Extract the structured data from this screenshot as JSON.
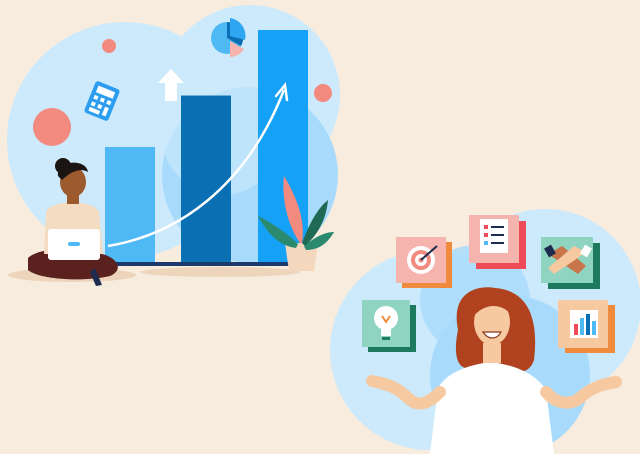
{
  "illustration": {
    "colors": {
      "background": "#f8ecde",
      "circle_light": "#cdeafc",
      "circle_mid": "#a8dbfb",
      "bar_light": "#4fb9f5",
      "bar_dark": "#0b6fb3",
      "bar_bright": "#15a1f6",
      "accent_coral": "#f28a80",
      "skin_dark": "#9c5a2d",
      "skin_light": "#f6c9a0",
      "hair_red": "#b0421f",
      "pants": "#5a211f"
    },
    "growth_chart": {
      "bar_levels": [
        0.5,
        0.72,
        1.0
      ]
    },
    "left_scene": {
      "floating_icons": [
        "calculator-icon",
        "pie-chart-icon",
        "arrow-up-icon"
      ],
      "figures": [
        "person-with-laptop",
        "potted-plant"
      ]
    },
    "right_scene": {
      "cards": [
        "target-icon",
        "checklist-icon",
        "handshake-icon",
        "lightbulb-icon",
        "bar-chart-icon"
      ],
      "figures": [
        "smiling-woman"
      ]
    }
  }
}
